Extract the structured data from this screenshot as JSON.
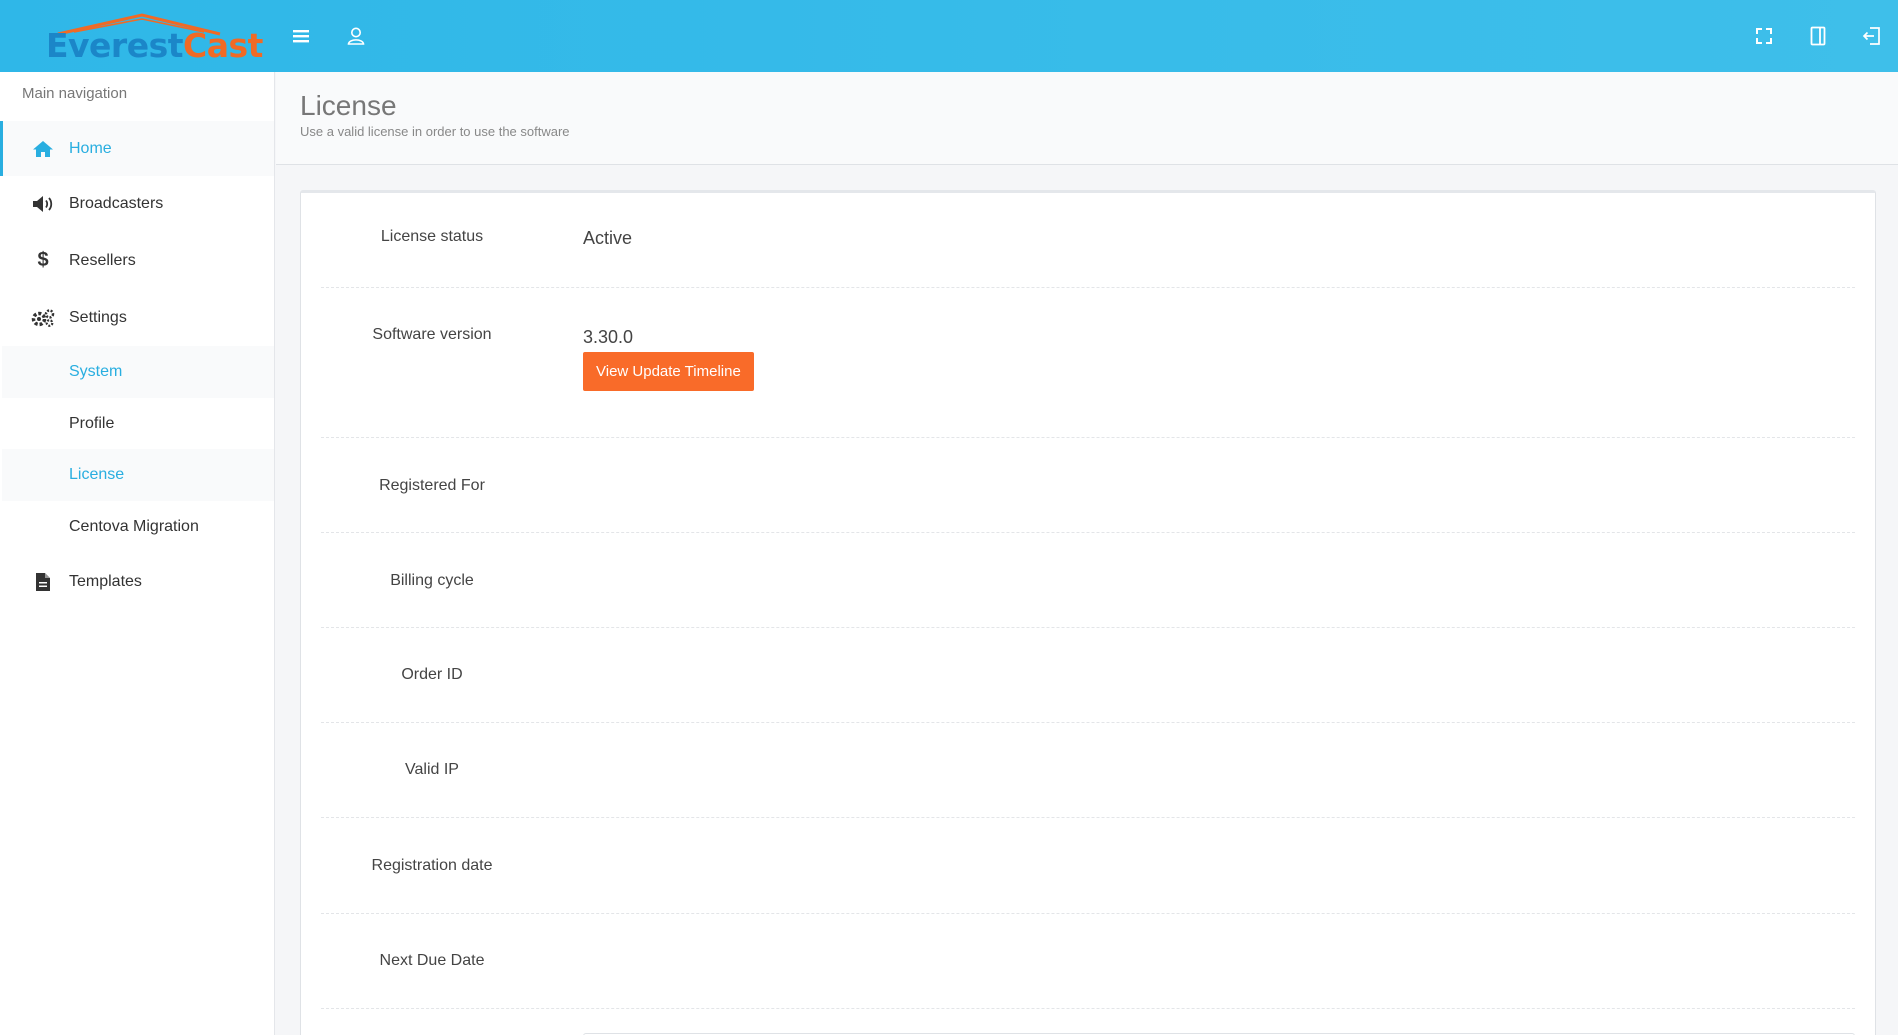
{
  "brand": {
    "part1": "Everest",
    "part2": "Cast",
    "color_primary": "#1b86c8",
    "color_secondary": "#f06a25"
  },
  "topbar": {
    "color": "#35b9e8",
    "left_icons": [
      "menu-icon",
      "user-icon"
    ],
    "right_icons": [
      "fullscreen-icon",
      "panel-icon",
      "logout-icon"
    ]
  },
  "sidebar": {
    "heading": "Main navigation",
    "items": [
      {
        "label": "Home",
        "icon": "home-icon",
        "active": true
      },
      {
        "label": "Broadcasters",
        "icon": "volume-icon"
      },
      {
        "label": "Resellers",
        "icon": "dollar-icon"
      },
      {
        "label": "Settings",
        "icon": "gears-icon",
        "children": [
          {
            "label": "System",
            "highlight": true
          },
          {
            "label": "Profile"
          },
          {
            "label": "License",
            "highlight": true
          },
          {
            "label": "Centova Migration"
          }
        ]
      },
      {
        "label": "Templates",
        "icon": "file-icon"
      }
    ],
    "accent": "#29aee0"
  },
  "header": {
    "title": "License",
    "subtitle": "Use a valid license in order to use the software"
  },
  "license": {
    "rows": [
      {
        "label": "License status",
        "value": "Active"
      },
      {
        "label": "Software version",
        "value": "3.30.0",
        "button": "View Update Timeline"
      },
      {
        "label": "Registered For",
        "value": ""
      },
      {
        "label": "Billing cycle",
        "value": ""
      },
      {
        "label": "Order ID",
        "value": ""
      },
      {
        "label": "Valid IP",
        "value": ""
      },
      {
        "label": "Registration date",
        "value": ""
      },
      {
        "label": "Next Due Date",
        "value": ""
      }
    ],
    "button_color": "#f96b29"
  }
}
